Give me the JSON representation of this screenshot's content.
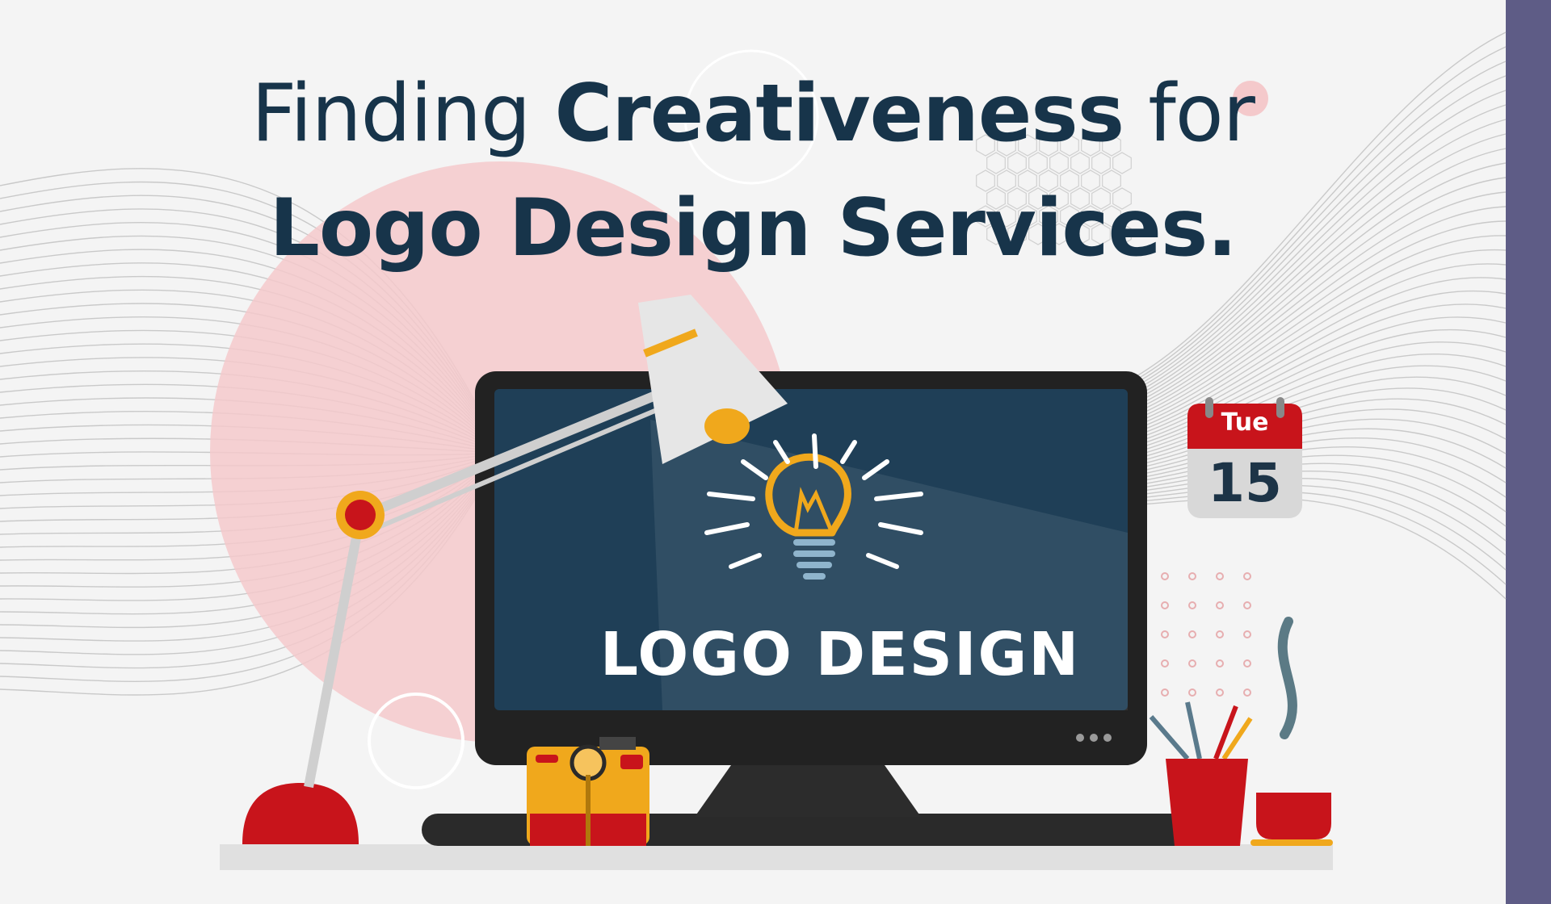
{
  "headline": {
    "line1_light": "Finding ",
    "line1_bold": "Creativeness",
    "line1_end": " for",
    "line2": "Logo Design Services."
  },
  "monitor": {
    "screen_label": "LOGO DESIGN",
    "icon": "lightbulb-icon"
  },
  "calendar": {
    "day": "Tue",
    "date": "15"
  },
  "colors": {
    "navy": "#17344a",
    "screen": "#1f3f57",
    "red": "#c8141b",
    "pink": "#f4c9cb",
    "yellow": "#f0a81c",
    "sidebar": "#5e5c86"
  }
}
